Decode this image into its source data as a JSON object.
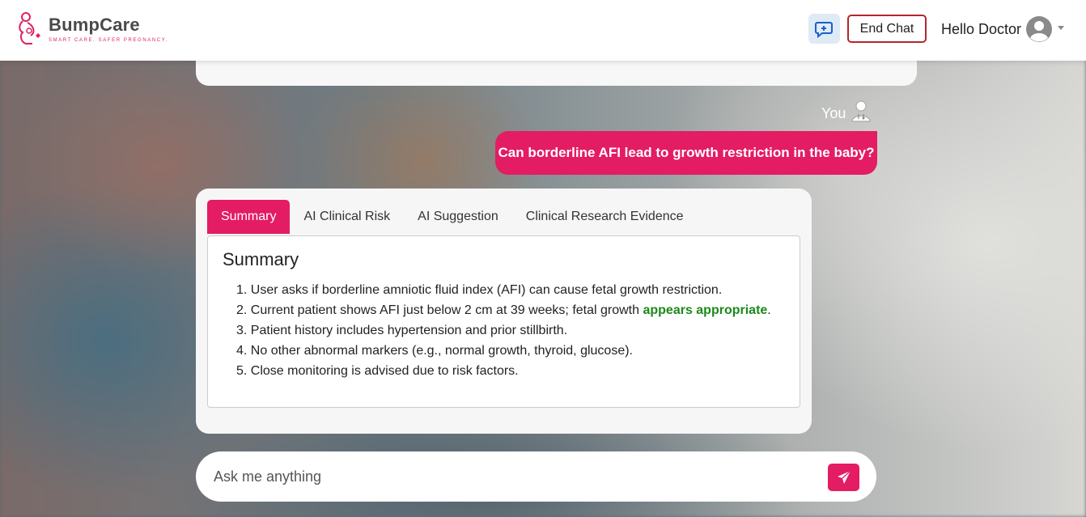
{
  "brand": {
    "name": "BumpCare",
    "tagline": "SMART CARE. SAFER PREGNANCY."
  },
  "header": {
    "end_chat_label": "End Chat",
    "greeting": "Hello Doctor"
  },
  "conversation": {
    "user_label": "You",
    "user_message": "Can borderline AFI lead to growth restriction in the baby?"
  },
  "answer": {
    "tabs": [
      {
        "label": "Summary",
        "active": true
      },
      {
        "label": "AI Clinical Risk",
        "active": false
      },
      {
        "label": "AI Suggestion",
        "active": false
      },
      {
        "label": "Clinical Research Evidence",
        "active": false
      }
    ],
    "panel_title": "Summary",
    "items": [
      {
        "num": "1.",
        "text": "User asks if borderline amniotic fluid index (AFI) can cause fetal growth restriction."
      },
      {
        "num": "2.",
        "text": "Current patient shows AFI just below 2 cm at 39 weeks; fetal growth ",
        "highlight": "appears appropriate",
        "after": "."
      },
      {
        "num": "3.",
        "text": "Patient history includes hypertension and prior stillbirth."
      },
      {
        "num": "4.",
        "text": "No other abnormal markers (e.g., normal growth, thyroid, glucose)."
      },
      {
        "num": "5.",
        "text": "Close monitoring is advised due to risk factors."
      }
    ]
  },
  "composer": {
    "placeholder": "Ask me anything"
  },
  "colors": {
    "accent": "#e31c63",
    "end_chat_border": "#b3262d",
    "highlight_text": "#1a8a1a",
    "new_chat_bg": "#dfeaf7"
  },
  "icons": {
    "new_chat": "chat-plus-icon",
    "avatar": "user-avatar-icon",
    "you": "doctor-icon",
    "send": "paper-plane-icon"
  }
}
